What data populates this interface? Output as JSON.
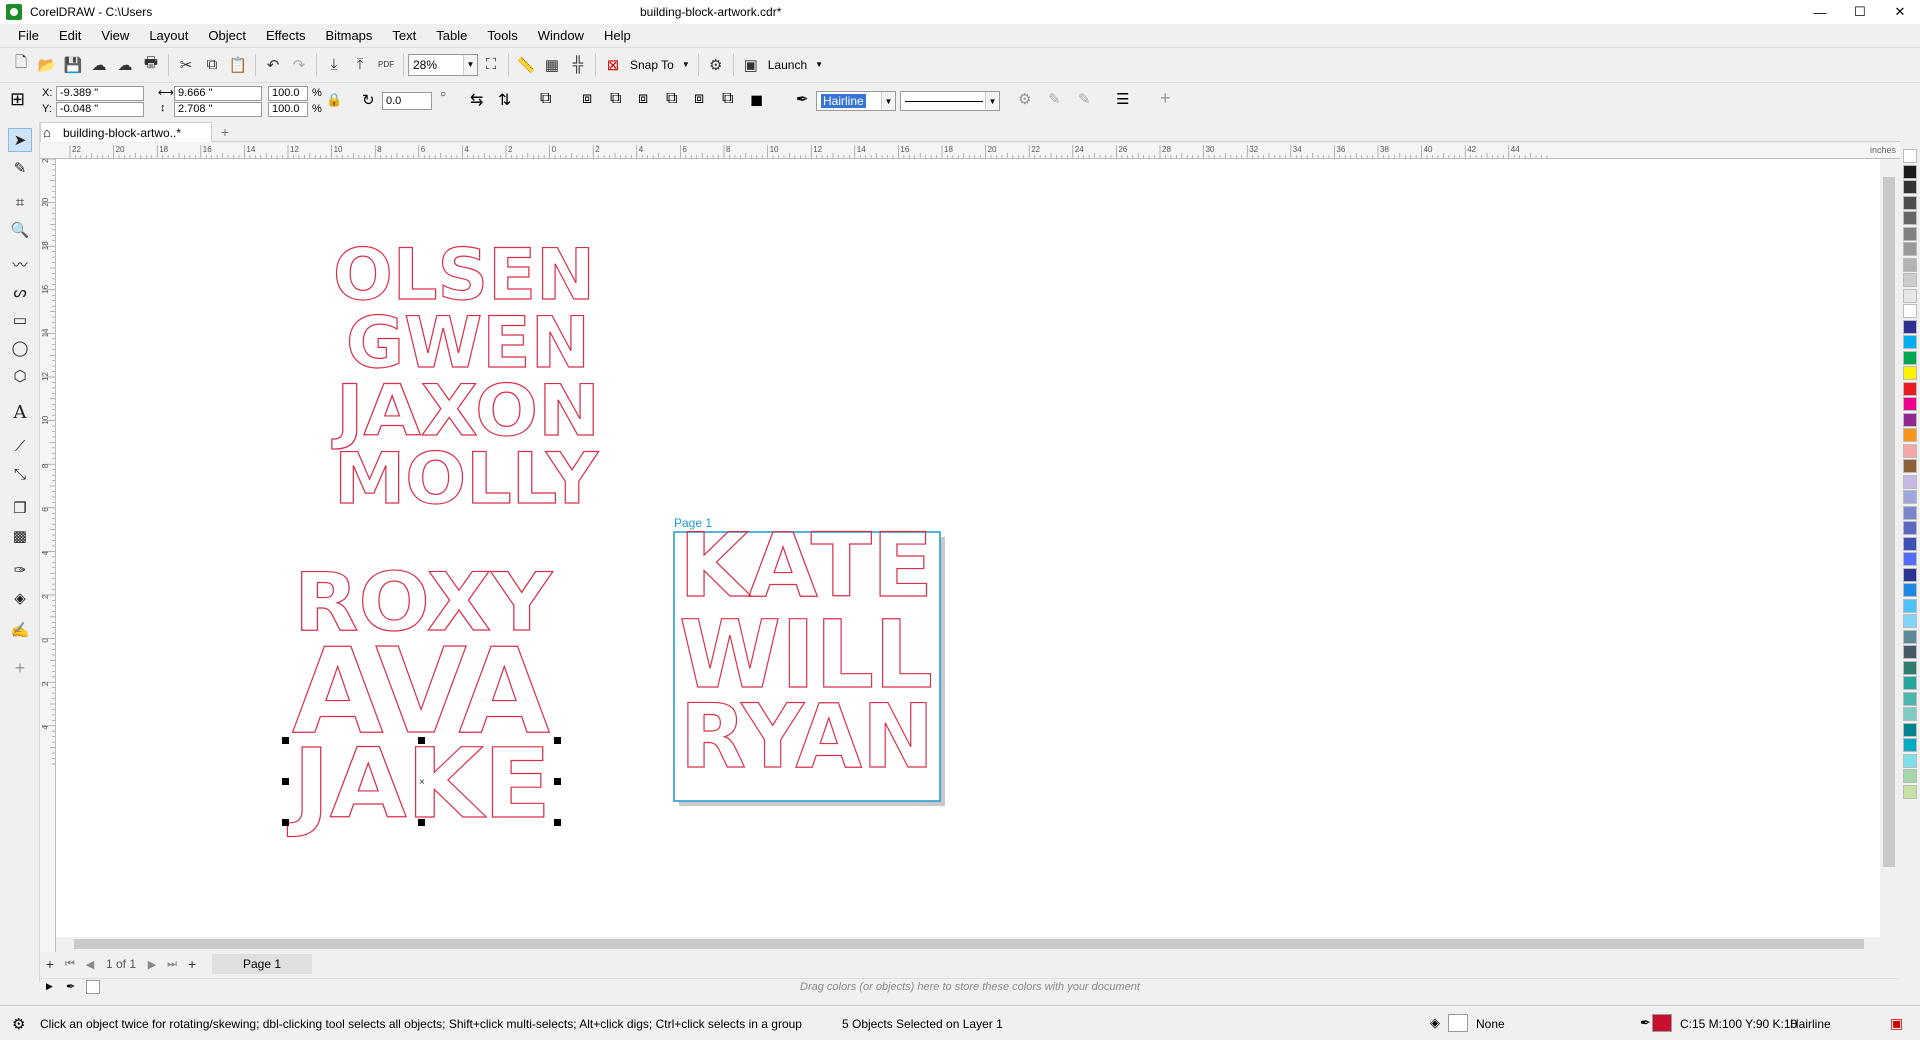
{
  "titlebar": {
    "app_title": "CorelDRAW - C:\\Users",
    "doc_title": "building-block-artwork.cdr*",
    "minimize": "—",
    "maximize": "☐",
    "close": "✕"
  },
  "menu": [
    "File",
    "Edit",
    "View",
    "Layout",
    "Object",
    "Effects",
    "Bitmaps",
    "Text",
    "Table",
    "Tools",
    "Window",
    "Help"
  ],
  "toolbar": {
    "zoom": "28%",
    "snap_to": "Snap To",
    "launch": "Launch",
    "pdf_label": "PDF"
  },
  "propbar": {
    "x_label": "X:",
    "y_label": "Y:",
    "x_value": "-9.389 \"",
    "y_value": "-0.048 \"",
    "w_value": "9.666 \"",
    "h_value": "2.708 \"",
    "scale_x": "100.0",
    "scale_y": "100.0",
    "pct": "%",
    "rotation": "0.0",
    "outline_width": "Hairline"
  },
  "doc_tab": {
    "label": "building-block-artwo..*"
  },
  "rulers": {
    "unit": "inches",
    "h_labels": [
      "22",
      "20",
      "18",
      "16",
      "14",
      "12",
      "10",
      "8",
      "6",
      "4",
      "2",
      "0",
      "2",
      "4",
      "6",
      "8",
      "10",
      "12",
      "14",
      "16",
      "18",
      "20",
      "22",
      "24",
      "26",
      "28",
      "30",
      "32",
      "34",
      "36",
      "38",
      "40",
      "42",
      "44"
    ],
    "v_labels": [
      "22",
      "20",
      "18",
      "16",
      "14",
      "12",
      "10",
      "8",
      "6",
      "4",
      "2",
      "0",
      "2",
      "4"
    ]
  },
  "canvas": {
    "page_label": "Page 1",
    "group1": [
      "OLSEN",
      "GWEN",
      "JAXON",
      "MOLLY"
    ],
    "group2": [
      "ROXY",
      "AVA",
      "JAKE"
    ],
    "group3": [
      "KATE",
      "WILL",
      "RYAN"
    ],
    "outline_color": "#d9304a"
  },
  "pagenav": {
    "page_count": "1 of 1",
    "page_tab": "Page 1"
  },
  "docpalette": {
    "hint": "Drag colors (or objects) here to store these colors with your document"
  },
  "status": {
    "hint": "Click an object twice for rotating/skewing; dbl-clicking tool selects all objects; Shift+click multi-selects; Alt+click digs; Ctrl+click selects in a group",
    "selection": "5 Objects Selected on Layer 1",
    "fill": "None",
    "outline_color_text": "C:15 M:100 Y:90 K:10",
    "outline_width": "Hairline",
    "outline_swatch": "#c8102e"
  },
  "palette_colors": [
    "#ffffff",
    "#1a1a1a",
    "#333333",
    "#4d4d4d",
    "#666666",
    "#808080",
    "#999999",
    "#b3b3b3",
    "#cccccc",
    "#e6e6e6",
    "#ffffff",
    "#2e3192",
    "#00aeef",
    "#00a651",
    "#fff200",
    "#ed1c24",
    "#ec008c",
    "#92278f",
    "#f7941d",
    "#f6a6a6",
    "#8c6239",
    "#c7b8e8",
    "#9fa8da",
    "#7986cb",
    "#5c6bc0",
    "#3f51b5",
    "#536dfe",
    "#283593",
    "#1e88e5",
    "#4fc3f7",
    "#81d4fa",
    "#5c8a99",
    "#455a64",
    "#2e7d6f",
    "#26a69a",
    "#4db6ac",
    "#80cbc4",
    "#00838f",
    "#00acc1",
    "#80deea",
    "#a5d6a7",
    "#c5e1a5"
  ]
}
